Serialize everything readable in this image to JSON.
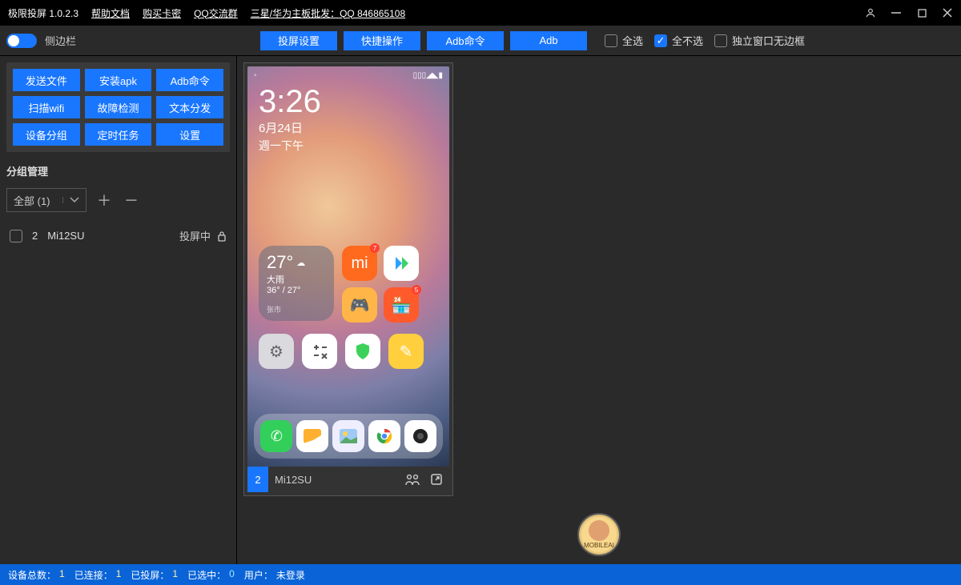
{
  "title": {
    "app": "极限投屏 1.0.2.3",
    "help": "帮助文档",
    "buy": "购买卡密",
    "qq": "QQ交流群",
    "promo": "三星/华为主板批发：QQ 846865108"
  },
  "toolbar": {
    "sidebar_label": "侧边栏",
    "buttons": {
      "settings": "投屏设置",
      "quick": "快捷操作",
      "adbcmd": "Adb命令",
      "adb": "Adb"
    },
    "check_all": "全选",
    "check_none": "全不选",
    "check_borderless": "独立窗口无边框"
  },
  "sidebar": {
    "actions": {
      "send_file": "发送文件",
      "install_apk": "安装apk",
      "adbcmd": "Adb命令",
      "scan_wifi": "扫描wifi",
      "diagnose": "故障检测",
      "text_dist": "文本分发",
      "group": "设备分组",
      "cron": "定时任务",
      "settings": "设置"
    },
    "group_mgmt": "分组管理",
    "group_select": "全部 (1)",
    "device": {
      "index": "2",
      "name": "Mi12SU",
      "status": "投屏中"
    }
  },
  "phone": {
    "time": "3:26",
    "date": "6月24日",
    "day": "週一下午",
    "weather": {
      "temp": "27°",
      "cond": "大雨",
      "range": "36° / 27°",
      "loc": "张市"
    },
    "footer": {
      "index": "2",
      "name": "Mi12SU"
    }
  },
  "watermark": "MOBILEAI",
  "status": {
    "total_l": "设备总数：",
    "total_v": "1",
    "conn_l": "已连接：",
    "conn_v": "1",
    "cast_l": "已投屏：",
    "cast_v": "1",
    "sel_l": "已选中：",
    "sel_v": "0",
    "user_l": "用户：",
    "user_v": "未登录"
  },
  "colors": {
    "accent": "#1976ff"
  }
}
